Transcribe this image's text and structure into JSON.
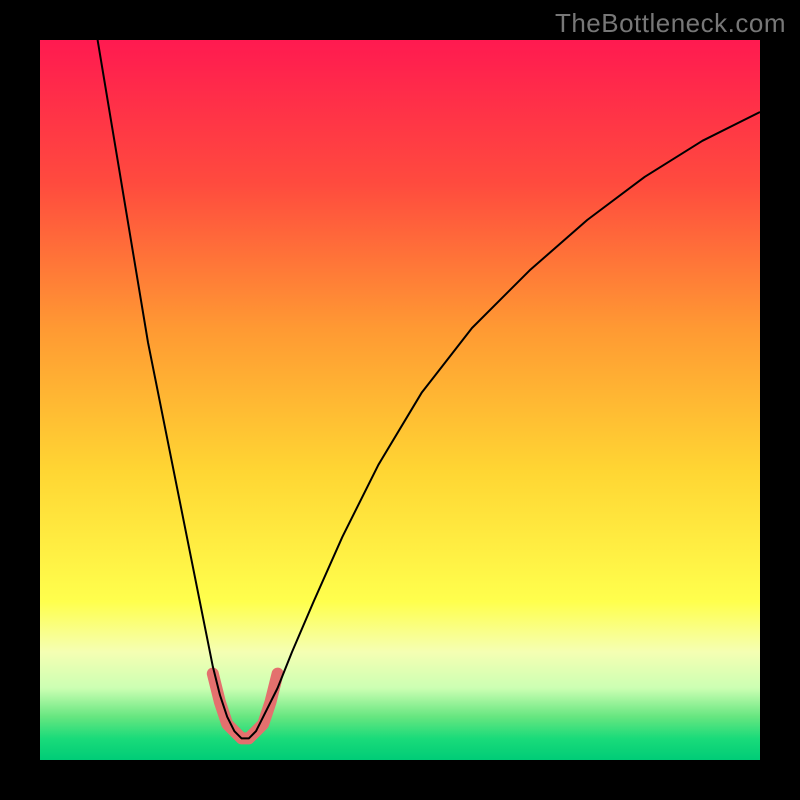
{
  "watermark": "TheBottleneck.com",
  "chart_data": {
    "type": "line",
    "title": "",
    "xlabel": "",
    "ylabel": "",
    "xlim": [
      0,
      100
    ],
    "ylim": [
      0,
      100
    ],
    "grid": false,
    "legend": false,
    "gradient_stops": [
      {
        "offset": 0.0,
        "color": "#ff1a50"
      },
      {
        "offset": 0.2,
        "color": "#ff4b3e"
      },
      {
        "offset": 0.4,
        "color": "#ff9933"
      },
      {
        "offset": 0.6,
        "color": "#ffd633"
      },
      {
        "offset": 0.78,
        "color": "#ffff4d"
      },
      {
        "offset": 0.85,
        "color": "#f5ffb3"
      },
      {
        "offset": 0.9,
        "color": "#ccffb3"
      },
      {
        "offset": 0.94,
        "color": "#66e680"
      },
      {
        "offset": 0.97,
        "color": "#1adb7a"
      },
      {
        "offset": 1.0,
        "color": "#00cc77"
      }
    ],
    "series": [
      {
        "name": "curve",
        "stroke": "#000000",
        "stroke_width": 2,
        "x": [
          8,
          9,
          10,
          11,
          12,
          13,
          14,
          15,
          16,
          17,
          18,
          19,
          20,
          21,
          22,
          23,
          24,
          25,
          26,
          27,
          28,
          29,
          30,
          31,
          33,
          35,
          38,
          42,
          47,
          53,
          60,
          68,
          76,
          84,
          92,
          100
        ],
        "y": [
          100,
          94,
          88,
          82,
          76,
          70,
          64,
          58,
          53,
          48,
          43,
          38,
          33,
          28,
          23,
          18,
          13,
          9,
          6,
          4,
          3,
          3,
          4,
          6,
          10,
          15,
          22,
          31,
          41,
          51,
          60,
          68,
          75,
          81,
          86,
          90
        ]
      },
      {
        "name": "trough-marker",
        "type": "marker-band",
        "stroke": "#e4706e",
        "stroke_width": 12,
        "linecap": "round",
        "x": [
          24,
          25,
          26,
          27,
          28,
          29,
          30,
          31,
          32,
          33
        ],
        "y": [
          12,
          8,
          5,
          4,
          3,
          3,
          4,
          5,
          8,
          12
        ]
      }
    ]
  }
}
